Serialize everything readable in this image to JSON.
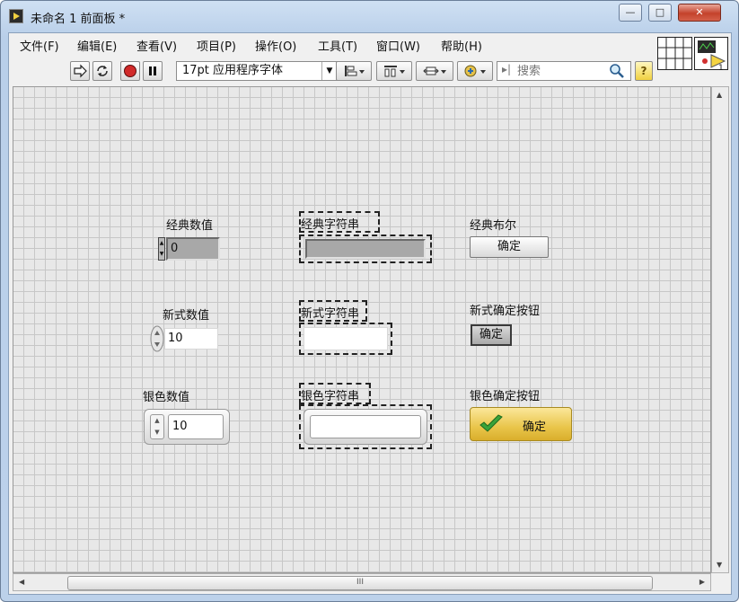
{
  "window": {
    "title": "未命名 1 前面板 *",
    "controls": {
      "minimize": "—",
      "maximize": "□",
      "close": "✕"
    }
  },
  "menu": [
    "文件(F)",
    "编辑(E)",
    "查看(V)",
    "项目(P)",
    "操作(O)",
    "工具(T)",
    "窗口(W)",
    "帮助(H)"
  ],
  "toolbar": {
    "font": "17pt 应用程序字体",
    "search_placeholder": "搜索",
    "help_label": "?"
  },
  "icons": {
    "run": "arrow-right-icon",
    "run_continuously": "loop-arrows-icon",
    "abort": "stop-icon",
    "pause": "pause-icon",
    "align": "align-objects-icon",
    "distribute": "distribute-objects-icon",
    "resize": "resize-objects-icon",
    "reorder": "reorder-icon",
    "search": "magnifier-icon",
    "help": "question-icon"
  },
  "front_panel": {
    "classic_numeric": {
      "label": "经典数值",
      "value": "0"
    },
    "classic_string": {
      "label": "经典字符串",
      "value": ""
    },
    "classic_boolean": {
      "label": "经典布尔",
      "button": "确定"
    },
    "modern_numeric": {
      "label": "新式数值",
      "value": "10"
    },
    "modern_string": {
      "label": "新式字符串",
      "value": ""
    },
    "modern_button": {
      "label": "新式确定按钮",
      "button": "确定"
    },
    "silver_numeric": {
      "label": "银色数值",
      "value": "10"
    },
    "silver_string": {
      "label": "银色字符串",
      "value": ""
    },
    "silver_button": {
      "label": "银色确定按钮",
      "button": "确定"
    }
  },
  "scrollbar": {
    "thumb_grip": "III"
  },
  "colors": {
    "grid": "#c7c7c7",
    "canvas_bg": "#e8e8e8",
    "classic_gray": "#a8a8a8",
    "silver_button_gold": "#e9c54a",
    "check_green": "#3aa33a"
  }
}
